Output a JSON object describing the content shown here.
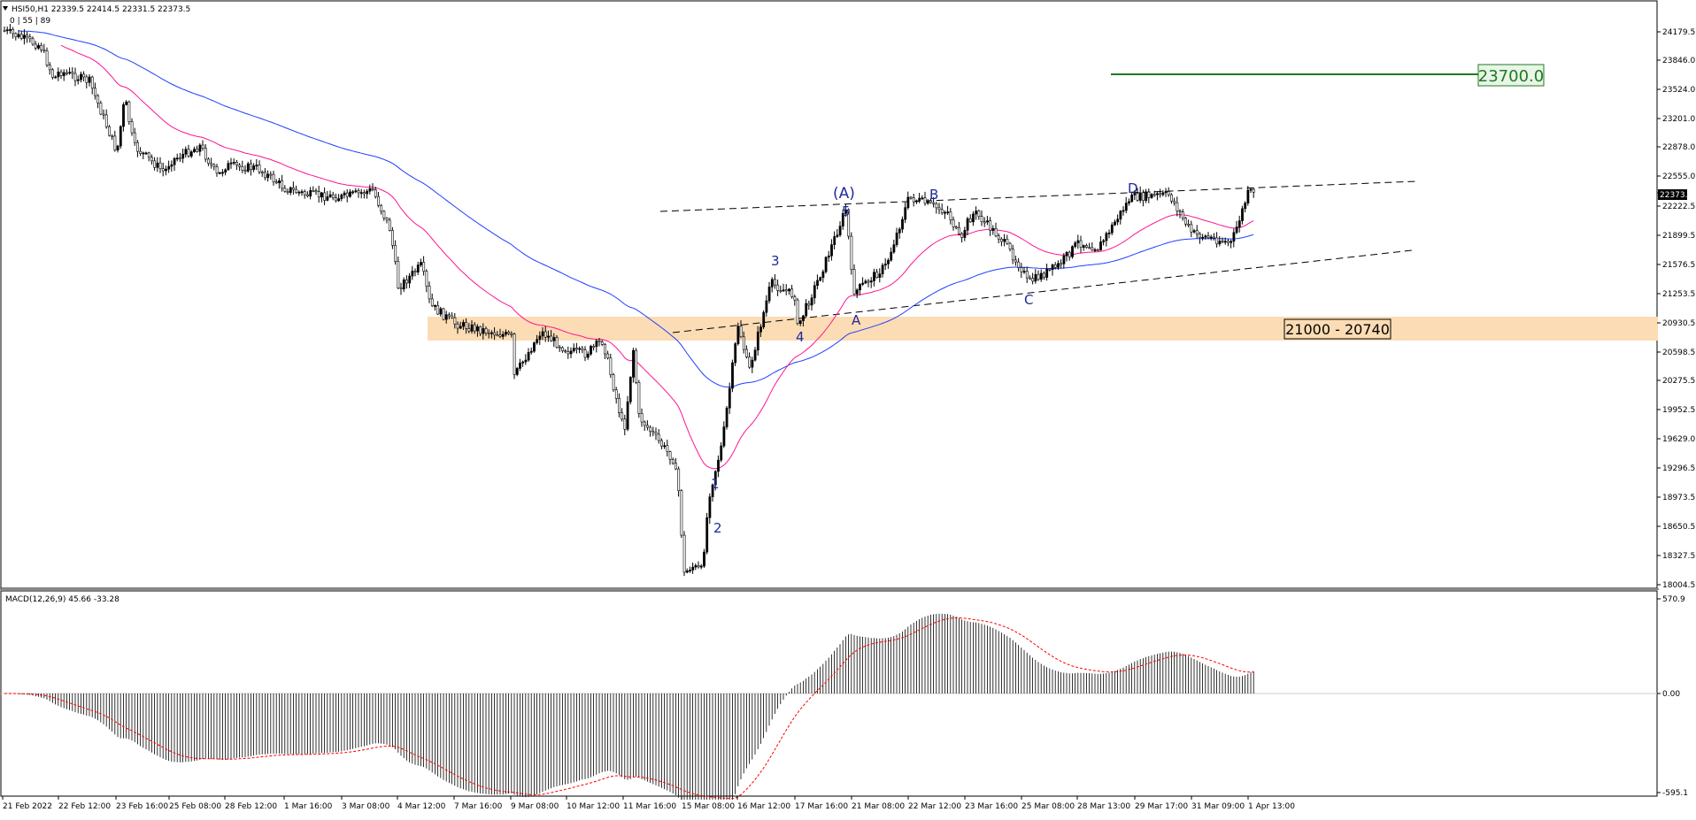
{
  "header": {
    "symbol_line": "HSI50,H1  22339.5 22414.5 22331.5 22373.5",
    "ma_line": "0 | 55 | 89"
  },
  "colors": {
    "candle": "#000000",
    "ma_fast": "#ff1493",
    "ma_slow": "#1f3fff",
    "support_zone": "#fbdcb4",
    "target_line": "#1f7a1f",
    "macd_signal": "#ff0000",
    "price_tag_bg": "#000000"
  },
  "price_axis": {
    "ticks": [
      "24179.5",
      "23846.0",
      "23524.0",
      "23201.0",
      "22878.0",
      "22555.0",
      "22373.5",
      "22222.5",
      "21899.5",
      "21576.5",
      "21253.5",
      "20930.5",
      "20598.5",
      "20275.5",
      "19952.5",
      "19629.0",
      "19296.5",
      "18973.5",
      "18650.5",
      "18327.5",
      "18004.5"
    ],
    "current_price": "22373.5"
  },
  "macd_panel": {
    "title": "MACD(12,26,9) 45.66 -33.28",
    "ticks": [
      "570.9",
      "0.00",
      "-595.1"
    ]
  },
  "time_axis": {
    "labels": [
      "21 Feb 2022",
      "22 Feb 12:00",
      "23 Feb 16:00",
      "25 Feb 08:00",
      "28 Feb 12:00",
      "1 Mar 16:00",
      "3 Mar 08:00",
      "4 Mar 12:00",
      "7 Mar 16:00",
      "9 Mar 08:00",
      "10 Mar 12:00",
      "11 Mar 16:00",
      "15 Mar 08:00",
      "16 Mar 12:00",
      "17 Mar 16:00",
      "21 Mar 08:00",
      "22 Mar 12:00",
      "23 Mar 16:00",
      "25 Mar 08:00",
      "28 Mar 13:00",
      "29 Mar 17:00",
      "31 Mar 09:00",
      "1 Apr 13:00"
    ]
  },
  "annotations": {
    "target_label": "23700.0",
    "zone_label": "21000 - 20740",
    "waves": {
      "w1": "1",
      "w2": "2",
      "w3": "3",
      "w4": "4",
      "w5": "5",
      "wA_big": "(A)",
      "A": "A",
      "B": "B",
      "C": "C",
      "D": "D"
    }
  },
  "chart_data": {
    "type": "line",
    "title": "HSI50,H1",
    "price_path": [
      {
        "t": "21 Feb 2022",
        "p": 24150
      },
      {
        "t": "22 Feb 12:00",
        "p": 23700
      },
      {
        "t": "23 Feb 16:00",
        "p": 22800
      },
      {
        "t": "25 Feb 08:00",
        "p": 22700
      },
      {
        "t": "28 Feb 12:00",
        "p": 22650
      },
      {
        "t": "1 Mar 16:00",
        "p": 22400
      },
      {
        "t": "3 Mar 08:00",
        "p": 22300
      },
      {
        "t": "4 Mar 12:00",
        "p": 21300
      },
      {
        "t": "7 Mar 16:00",
        "p": 20900
      },
      {
        "t": "9 Mar 08:00",
        "p": 20750
      },
      {
        "t": "10 Mar 12:00",
        "p": 20600
      },
      {
        "t": "11 Mar 16:00",
        "p": 19700
      },
      {
        "t": "15 Mar 08:00",
        "p": 18100
      },
      {
        "t": "16 Mar 12:00",
        "p": 20900
      },
      {
        "t": "17 Mar 16:00",
        "p": 21200
      },
      {
        "t": "21 Mar 08:00",
        "p": 21300
      },
      {
        "t": "22 Mar 12:00",
        "p": 22300
      },
      {
        "t": "23 Mar 16:00",
        "p": 22000
      },
      {
        "t": "25 Mar 08:00",
        "p": 21500
      },
      {
        "t": "28 Mar 13:00",
        "p": 21800
      },
      {
        "t": "29 Mar 17:00",
        "p": 22300
      },
      {
        "t": "31 Mar 09:00",
        "p": 21900
      },
      {
        "t": "1 Apr 13:00",
        "p": 22373.5
      }
    ],
    "levels": {
      "target": 23700.0,
      "support_zone": [
        20740,
        21000
      ]
    },
    "ylim": [
      18004.5,
      24350
    ]
  }
}
